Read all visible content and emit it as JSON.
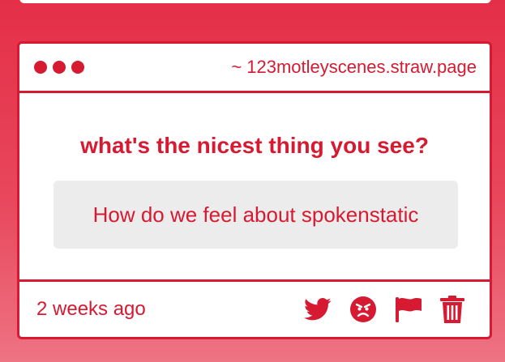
{
  "card": {
    "url": "~ 123motleyscenes.straw.page",
    "question": "what's the nicest thing you see?",
    "answer": "How do we feel about spokenstatic",
    "timestamp": "2 weeks ago",
    "actions": [
      "twitter-icon",
      "angry-face-icon",
      "flag-icon",
      "trash-icon"
    ]
  },
  "colors": {
    "accent": "#d61a32",
    "background_top": "#e42f47",
    "background_bottom": "#ee7383",
    "answer_bg": "#ececec"
  }
}
